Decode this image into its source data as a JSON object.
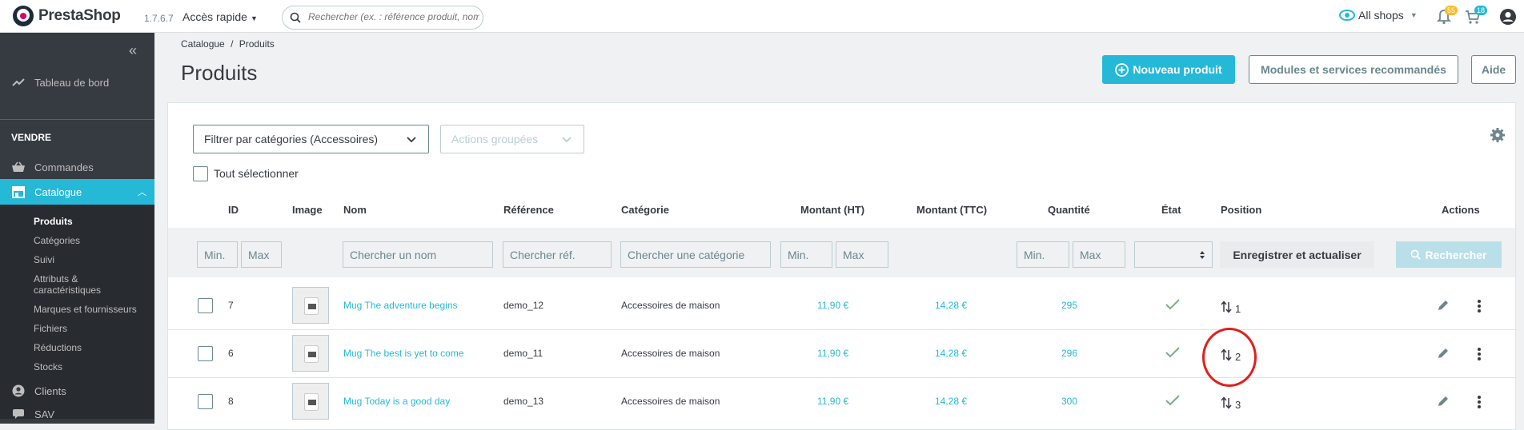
{
  "header": {
    "logo_text": "PrestaShop",
    "version": "1.7.6.7",
    "quick_access": "Accès rapide",
    "search_placeholder": "Rechercher (ex. : référence produit, nom",
    "shop_selector": "All shops",
    "notif_orders_count": "55",
    "notif_customers_count": "18"
  },
  "sidebar": {
    "dashboard": "Tableau de bord",
    "section_sell": "VENDRE",
    "orders": "Commandes",
    "catalog": "Catalogue",
    "catalog_sub": [
      "Produits",
      "Catégories",
      "Suivi",
      "Attributs &",
      "caractéristiques",
      "Marques et fournisseurs",
      "Fichiers",
      "Réductions",
      "Stocks"
    ],
    "customers": "Clients",
    "sav": "SAV"
  },
  "page": {
    "breadcrumb_1": "Catalogue",
    "breadcrumb_sep": "/",
    "breadcrumb_2": "Produits",
    "title": "Produits",
    "new_product": "Nouveau produit",
    "modules_button": "Modules et services recommandés",
    "help_button": "Aide"
  },
  "toolbar": {
    "category_filter": "Filtrer par catégories (Accessoires)",
    "bulk_actions": "Actions groupées",
    "select_all": "Tout sélectionner"
  },
  "table": {
    "headers": {
      "id": "ID",
      "image": "Image",
      "name": "Nom",
      "reference": "Référence",
      "category": "Catégorie",
      "price_ht": "Montant (HT)",
      "price_ttc": "Montant (TTC)",
      "quantity": "Quantité",
      "status": "État",
      "position": "Position",
      "actions": "Actions"
    },
    "filters": {
      "id_min": "Min.",
      "id_max": "Max",
      "name": "Chercher un nom",
      "reference": "Chercher réf.",
      "category": "Chercher une catégorie",
      "price_min": "Min.",
      "price_max": "Max",
      "qty_min": "Min.",
      "qty_max": "Max",
      "save_refresh": "Enregistrer et actualiser",
      "search": "Rechercher"
    },
    "rows": [
      {
        "id": "7",
        "name": "Mug The adventure begins",
        "reference": "demo_12",
        "category": "Accessoires de maison",
        "price_ht": "11,90 €",
        "price_ttc": "14,28 €",
        "quantity": "295",
        "position": "1"
      },
      {
        "id": "6",
        "name": "Mug The best is yet to come",
        "reference": "demo_11",
        "category": "Accessoires de maison",
        "price_ht": "11,90 €",
        "price_ttc": "14,28 €",
        "quantity": "296",
        "position": "2"
      },
      {
        "id": "8",
        "name": "Mug Today is a good day",
        "reference": "demo_13",
        "category": "Accessoires de maison",
        "price_ht": "11,90 €",
        "price_ttc": "14,28 €",
        "quantity": "300",
        "position": "3"
      }
    ]
  },
  "colors": {
    "accent": "#25b9d7",
    "sidebar_bg": "#363a41",
    "status_ok": "#70b580",
    "highlight_circle": "#e0201a"
  }
}
